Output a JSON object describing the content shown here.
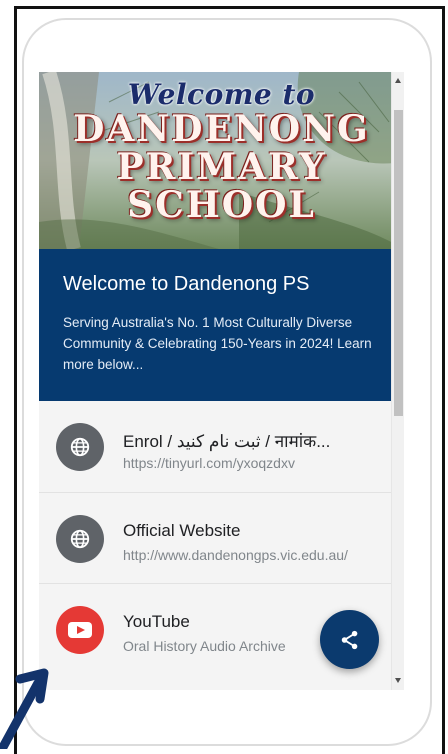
{
  "hero": {
    "script_title": "Welcome to",
    "line1": "DANDENONG",
    "line2": "PRIMARY",
    "line3": "SCHOOL"
  },
  "banner": {
    "title": "Welcome to Dandenong PS",
    "subtitle": "Serving Australia's No. 1 Most Culturally Diverse Community & Celebrating 150-Years in 2024! Learn more below..."
  },
  "links": [
    {
      "title": "Enrol / ثبت نام کنید / नामांक...",
      "url": "https://tinyurl.com/yxoqzdxv",
      "icon": "globe-icon"
    },
    {
      "title": "Official Website",
      "url": "http://www.dandenongps.vic.edu.au/",
      "icon": "globe-icon"
    },
    {
      "title": "YouTube",
      "url": "Oral History Audio Archive",
      "icon": "youtube-icon"
    }
  ],
  "fab": {
    "icon": "share-icon"
  },
  "colors": {
    "banner_bg": "#063a70",
    "fab_bg": "#0b3a6e",
    "youtube_red": "#e53935",
    "globe_grey": "#5f6368"
  }
}
